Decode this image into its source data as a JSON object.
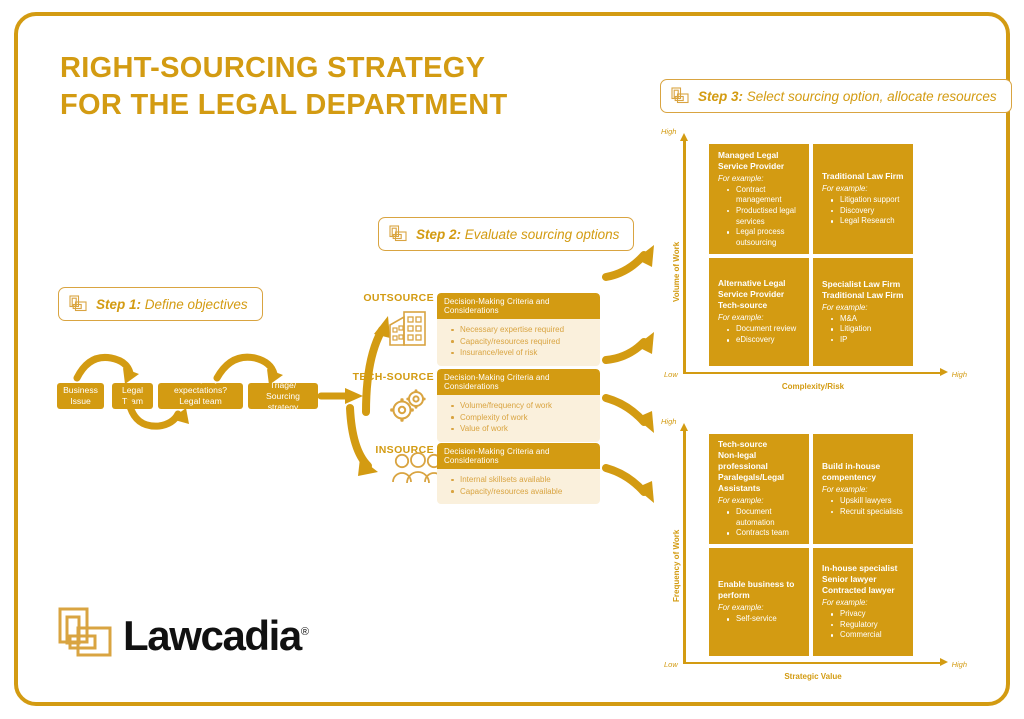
{
  "theme": {
    "gold": "#D39B12",
    "gold_light": "#D9A441",
    "cream": "#FAF0DC",
    "white": "#FFFFFF",
    "black": "#111111"
  },
  "title": {
    "line1": "RIGHT-SOURCING STRATEGY",
    "line2": "FOR THE LEGAL DEPARTMENT"
  },
  "steps": {
    "step1": {
      "num": "Step 1:",
      "text": " Define objectives"
    },
    "step2": {
      "num": "Step 2:",
      "text": " Evaluate sourcing options"
    },
    "step3": {
      "num": "Step 3:",
      "text": " Select sourcing option, allocate resources"
    }
  },
  "flow": {
    "boxes": [
      {
        "line1": "Business",
        "line2": "Issue"
      },
      {
        "line1": "Legal",
        "line2": "Team"
      },
      {
        "line1": "Company expectations?",
        "line2": "Legal team objectives?"
      },
      {
        "line1": "Triage/",
        "line2": "Sourcing strategy"
      }
    ]
  },
  "options": [
    {
      "label": "OUTSOURCE",
      "icon": "office-building-icon",
      "criteria_title": "Decision-Making Criteria and Considerations",
      "criteria": [
        "Necessary expertise required",
        "Capacity/resources required",
        "Insurance/level of risk"
      ]
    },
    {
      "label": "TECH-SOURCE",
      "icon": "gears-icon",
      "criteria_title": "Decision-Making Criteria and Considerations",
      "criteria": [
        "Volume/frequency of work",
        "Complexity of work",
        "Value of work"
      ]
    },
    {
      "label": "INSOURCE",
      "icon": "people-group-icon",
      "criteria_title": "Decision-Making Criteria and Considerations",
      "criteria": [
        "Internal skillsets available",
        "Capacity/resources available"
      ]
    }
  ],
  "chart_data": [
    {
      "type": "matrix",
      "id": "sourcing-matrix-top",
      "title": "",
      "xlabel": "Complexity/Risk",
      "ylabel": "Volume of Work",
      "x_low": "Low",
      "x_high": "High",
      "y_low": "Low",
      "y_high": "High",
      "quadrants": [
        {
          "position": "top-left",
          "x": "low",
          "y": "high",
          "title_lines": [
            "Managed Legal",
            "Service Provider"
          ],
          "example_label": "For example:",
          "examples": [
            "Contract management",
            "Productised legal services",
            "Legal process outsourcing"
          ]
        },
        {
          "position": "top-right",
          "x": "high",
          "y": "high",
          "title_lines": [
            "Traditional Law Firm"
          ],
          "example_label": "For example:",
          "examples": [
            "Litigation support",
            "Discovery",
            "Legal Research"
          ]
        },
        {
          "position": "bottom-left",
          "x": "low",
          "y": "low",
          "title_lines": [
            "Alternative Legal",
            "Service Provider",
            "Tech-source"
          ],
          "example_label": "For example:",
          "examples": [
            "Document review",
            "eDiscovery"
          ]
        },
        {
          "position": "bottom-right",
          "x": "high",
          "y": "low",
          "title_lines": [
            "Specialist Law Firm",
            "Traditional Law Firm"
          ],
          "example_label": "For example:",
          "examples": [
            "M&A",
            "Litigation",
            "IP"
          ]
        }
      ]
    },
    {
      "type": "matrix",
      "id": "sourcing-matrix-bottom",
      "title": "",
      "xlabel": "Strategic Value",
      "ylabel": "Frequency of Work",
      "x_low": "Low",
      "x_high": "High",
      "y_low": "Low",
      "y_high": "High",
      "quadrants": [
        {
          "position": "top-left",
          "x": "low",
          "y": "high",
          "title_lines": [
            "Tech-source",
            "Non-legal professional",
            "Paralegals/Legal Assistants"
          ],
          "example_label": "For example:",
          "examples": [
            "Document automation",
            "Contracts team"
          ]
        },
        {
          "position": "top-right",
          "x": "high",
          "y": "high",
          "title_lines": [
            "Build in-house",
            "compentency"
          ],
          "example_label": "For example:",
          "examples": [
            "Upskill lawyers",
            "Recruit specialists"
          ]
        },
        {
          "position": "bottom-left",
          "x": "low",
          "y": "low",
          "title_lines": [
            "Enable business to perform"
          ],
          "example_label": "For example:",
          "examples": [
            "Self-service"
          ]
        },
        {
          "position": "bottom-right",
          "x": "high",
          "y": "low",
          "title_lines": [
            "In-house specialist",
            "Senior lawyer",
            "Contracted lawyer"
          ],
          "example_label": "For example:",
          "examples": [
            "Privacy",
            "Regulatory",
            "Commercial"
          ]
        }
      ]
    }
  ],
  "logo": {
    "wordmark": "Lawcadia",
    "registered": "®",
    "mark": "lawcadia-squares-logo"
  }
}
